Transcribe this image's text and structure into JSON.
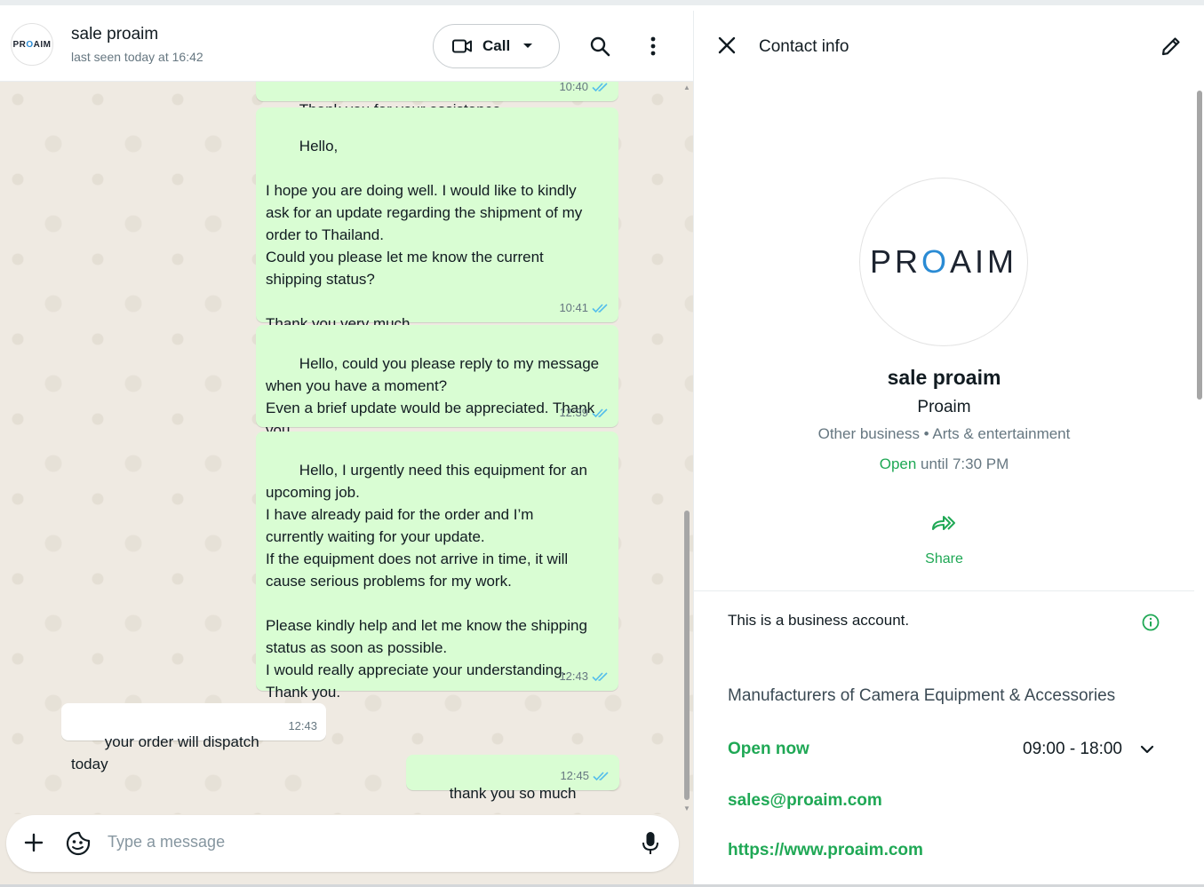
{
  "header": {
    "avatar_text_a": "PR",
    "avatar_text_b": "O",
    "avatar_text_c": "AIM",
    "contact_name": "sale proaim",
    "contact_status": "last seen today at 16:42",
    "call_label": "Call",
    "icons": [
      "video-icon",
      "chevron-down-icon",
      "search-icon",
      "menu-icon"
    ]
  },
  "messages": [
    {
      "direction": "out",
      "text": "Thank you for your assistance.",
      "time": "10:40",
      "status": "read"
    },
    {
      "direction": "out",
      "text": "Hello,\n\nI hope you are doing well. I would like to kindly\nask for an update regarding the shipment of my\norder to Thailand.\nCould you please let me know the current\nshipping status?\n\nThank you very much.",
      "time": "10:41",
      "status": "read"
    },
    {
      "direction": "out",
      "text": "Hello, could you please reply to my message\nwhen you have a moment?\nEven a brief update would be appreciated. Thank\nyou.",
      "time": "12:39",
      "status": "read"
    },
    {
      "direction": "out",
      "text": "Hello, I urgently need this equipment for an\nupcoming job.\nI have already paid for the order and I’m\ncurrently waiting for your update.\nIf the equipment does not arrive in time, it will\ncause serious problems for my work.\n\nPlease kindly help and let me know the shipping\nstatus as soon as possible.\nI would really appreciate your understanding.\nThank you.",
      "time": "12:43",
      "status": "read"
    },
    {
      "direction": "in",
      "text": "your order will dispatch today",
      "time": "12:43"
    },
    {
      "direction": "out",
      "text": "thank you so much",
      "time": "12:45",
      "status": "read"
    }
  ],
  "composer": {
    "placeholder": "Type a message",
    "icons": [
      "plus-icon",
      "sticker-icon",
      "mic-icon"
    ]
  },
  "info": {
    "title": "Contact info",
    "logo_a": "PR",
    "logo_b": "O",
    "logo_c": "AIM",
    "name": "sale proaim",
    "business_name": "Proaim",
    "category": "Other business • Arts & entertainment",
    "open_word": "Open",
    "open_until": " until 7:30 PM",
    "share_label": "Share",
    "business_note": "This is a business account.",
    "description": "Manufacturers of Camera Equipment & Accessories",
    "open_now": "Open now",
    "hours": "09:00 - 18:00",
    "email": "sales@proaim.com",
    "website": "https://www.proaim.com",
    "accent_color": "#1fa855",
    "bubble_color": "#d9fdd3",
    "tick_color": "#53bdeb"
  }
}
